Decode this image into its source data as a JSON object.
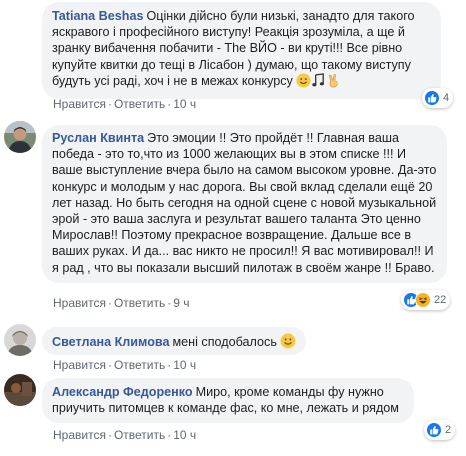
{
  "comments": [
    {
      "author": "Tatiana Beshas",
      "text": "Оцінки дійсно були низькі, занадто для такого яскравого і професійного виступу! Реакція зрозуміла, а ще й зранку вибачення побачити - The ВЙО - ви круті!!! Все рівно купуйте квитки до тещі в Лісабон ) думаю, що такому виступу будуть усі раді, хоч і не в межах конкурсу",
      "like_label": "Нравится",
      "reply_label": "Ответить",
      "time": "10 ч",
      "reaction_count": "4",
      "reactions": [
        "like"
      ]
    },
    {
      "author": "Руслан Квинта",
      "text": "Это эмоции !! Это пройдёт !! Главная ваша победа - это то,что из 1000 желающих вы в этом списке !!! И ваше выступление вчера было на самом высоком уровне. Да-это конкурс и молодым у нас дорога. Вы свой вклад сделали ещё 20 лет назад. Но быть сегодня на одной сцене с новой музыкальной эрой - это ваша заслуга и результат вашего таланта Это ценно Мирослав!! Поэтому прекрасное возвращение. Дальше все в ваших руках. И да... вас никто не просил!! Я вас мотивировал!! И я рад , что вы показали высший пилотаж в своём жанре !! Браво.",
      "like_label": "Нравится",
      "reply_label": "Ответить",
      "time": "9 ч",
      "reaction_count": "22",
      "reactions": [
        "like",
        "haha"
      ]
    },
    {
      "author": "Светлана Климова",
      "text": "мені сподобалось",
      "like_label": "Нравится",
      "reply_label": "Ответить",
      "time": "10 ч",
      "reaction_count": "",
      "reactions": []
    },
    {
      "author": "Александр Федоренко",
      "text": "Миро, кроме команды фу нужно приучить питомцев к команде фас, ко мне, лежать и рядом",
      "like_label": "Нравится",
      "reply_label": "Ответить",
      "time": "10 ч",
      "reaction_count": "2",
      "reactions": [
        "like"
      ]
    }
  ],
  "colors": {
    "author": "#385898",
    "bubble": "#f2f3f5",
    "meta": "#606770",
    "like": "#1877f2",
    "haha": "#f7b125"
  }
}
